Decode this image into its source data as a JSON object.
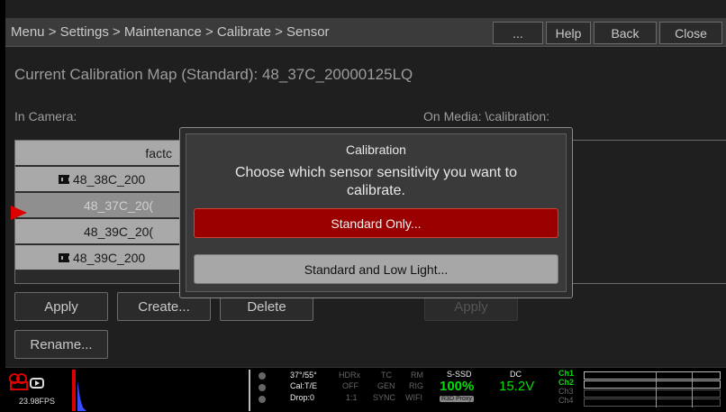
{
  "header": {
    "breadcrumb": "Menu > Settings > Maintenance > Calibrate > Sensor",
    "more_label": "...",
    "help_label": "Help",
    "back_label": "Back",
    "close_label": "Close"
  },
  "calibration_map": "Current Calibration Map (Standard): 48_37C_20000125LQ",
  "in_camera_label": "In Camera:",
  "on_media_label": "On Media: \\calibration:",
  "camera_list": [
    {
      "label": "factc"
    },
    {
      "label": "48_38C_200"
    },
    {
      "label": "48_37C_20("
    },
    {
      "label": "48_39C_20("
    },
    {
      "label": "48_39C_200"
    }
  ],
  "buttons": {
    "apply_label": "Apply",
    "create_label": "Create...",
    "delete_label": "Delete",
    "media_apply_label": "Apply",
    "rename_label": "Rename..."
  },
  "dialog": {
    "title": "Calibration",
    "message_line1": "Choose which sensor sensitivity you want to",
    "message_line2": "calibrate.",
    "option_standard": "Standard Only...",
    "option_standard_low": "Standard and Low Light..."
  },
  "status": {
    "fps": "23.98FPS",
    "temp": "37°/55°",
    "cal": "Cal:T/E",
    "drop": "Drop:0",
    "hdrx": "HDRx",
    "hdrx_val": "OFF",
    "ratio": "1:1",
    "tc": "TC",
    "gen": "GEN",
    "sync": "SYNC",
    "rm": "RM",
    "rig": "RIG",
    "wifi": "WIFI",
    "media_label": "S-SSD",
    "media_val": "100%",
    "media_badge": "R3D Proxy",
    "power_label": "DC",
    "power_val": "15.2V",
    "ch1": "Ch1",
    "ch2": "Ch2",
    "ch3": "Ch3",
    "ch4": "Ch4",
    "accent_red": "#cc0000",
    "accent_green": "#00e000"
  }
}
